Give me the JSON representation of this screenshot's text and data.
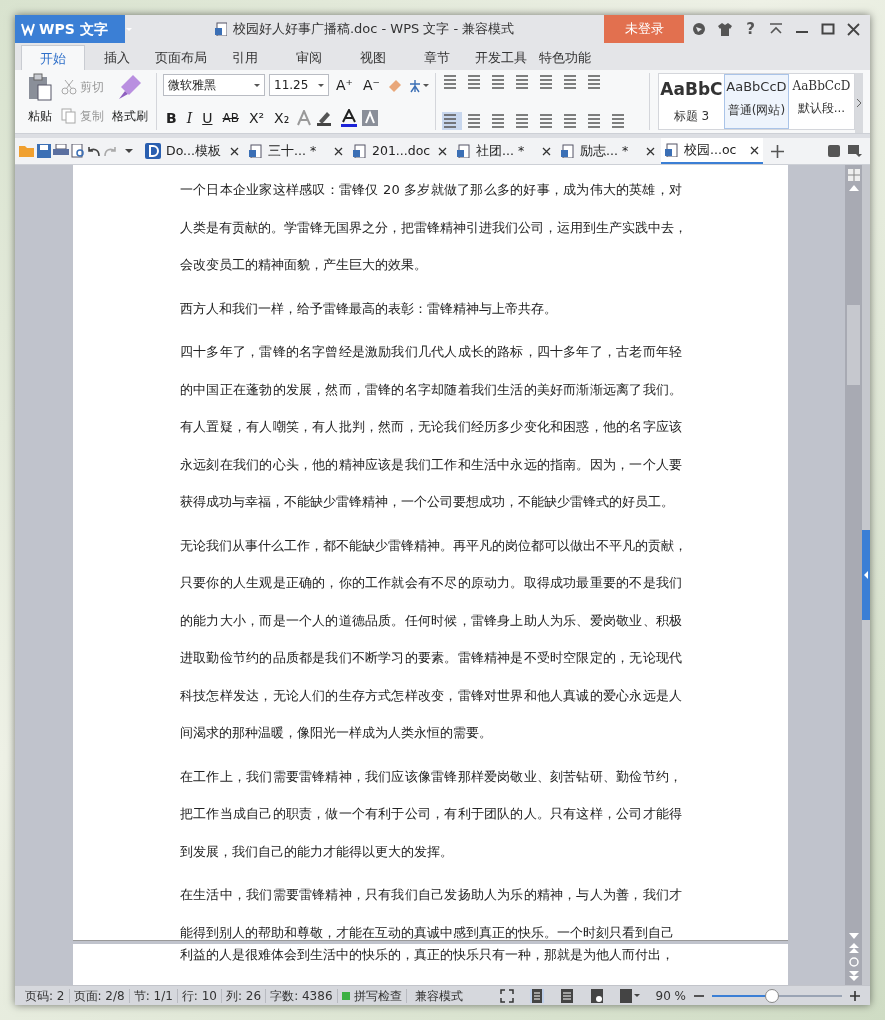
{
  "window": {
    "app_button": "WPS 文字",
    "title": "校园好人好事广播稿.doc - WPS 文字 - 兼容模式",
    "login_button": "未登录",
    "help": "?"
  },
  "menu_tabs": [
    {
      "label": "开始",
      "selected": true
    },
    {
      "label": "插入",
      "selected": false
    },
    {
      "label": "页面布局",
      "selected": false
    },
    {
      "label": "引用",
      "selected": false
    },
    {
      "label": "审阅",
      "selected": false
    },
    {
      "label": "视图",
      "selected": false
    },
    {
      "label": "章节",
      "selected": false
    },
    {
      "label": "开发工具",
      "selected": false
    },
    {
      "label": "特色功能",
      "selected": false
    }
  ],
  "ribbon": {
    "paste": "粘贴",
    "cut": {
      "label": "剪切",
      "disabled": true
    },
    "copy": {
      "label": "复制",
      "disabled": true
    },
    "format_painter": "格式刷",
    "font_name": "微软雅黑",
    "font_size": "11.25",
    "format_buttons": [
      {
        "glyph": "B",
        "kind": "bold"
      },
      {
        "glyph": "I",
        "kind": "italic"
      },
      {
        "glyph": "U",
        "kind": "underline"
      },
      {
        "glyph": "AB",
        "kind": "strike"
      },
      {
        "glyph": "X²",
        "kind": "plain"
      },
      {
        "glyph": "X₂",
        "kind": "plain"
      }
    ],
    "grow_font": "A⁺",
    "shrink_font": "A⁻",
    "styles": [
      {
        "preview": "AaBbC",
        "label": "标题 3",
        "kind": "heading",
        "selected": false
      },
      {
        "preview": "AaBbCcD",
        "label": "普通(网站)",
        "kind": "normal",
        "selected": true
      },
      {
        "preview": "AaBbCcD",
        "label": "默认段...",
        "kind": "serif",
        "selected": false
      }
    ]
  },
  "doc_tabs": [
    {
      "label": "Do...模板",
      "kind": "template",
      "selected": false
    },
    {
      "label": "三十... *",
      "kind": "document",
      "selected": false
    },
    {
      "label": "201...doc",
      "kind": "document",
      "selected": false
    },
    {
      "label": "社团... *",
      "kind": "document",
      "selected": false
    },
    {
      "label": "励志... *",
      "kind": "document",
      "selected": false
    },
    {
      "label": "校园...oc",
      "kind": "document",
      "selected": true
    }
  ],
  "pages": [
    {
      "paragraphs": [
        {
          "lines": [
            "一个日本企业家这样感叹：雷锋仅 20 多岁就做了那么多的好事，成为伟大的英雄，对",
            "人类是有贡献的。学雷锋无国界之分，把雷锋精神引进我们公司，运用到生产实践中去，",
            "会改变员工的精神面貌，产生巨大的效果。"
          ]
        },
        {
          "lines": [
            "西方人和我们一样，给予雷锋最高的表彰：雷锋精神与上帝共存。"
          ]
        },
        {
          "lines": [
            "四十多年了，雷锋的名字曾经是激励我们几代人成长的路标，四十多年了，古老而年轻",
            "的中国正在蓬勃的发展，然而，雷锋的名字却随着我们生活的美好而渐渐远离了我们。",
            "有人置疑，有人嘲笑，有人批判，然而，无论我们经历多少变化和困惑，他的名字应该",
            "永远刻在我们的心头，他的精神应该是我们工作和生活中永远的指南。因为，一个人要",
            "获得成功与幸福，不能缺少雷锋精神，一个公司要想成功，不能缺少雷锋式的好员工。"
          ]
        },
        {
          "lines": [
            "无论我们从事什么工作，都不能缺少雷锋精神。再平凡的岗位都可以做出不平凡的贡献，",
            "只要你的人生观是正确的，你的工作就会有不尽的原动力。取得成功最重要的不是我们",
            "的能力大小，而是一个人的道德品质。任何时候，雷锋身上助人为乐、爱岗敬业、积极",
            "进取勤俭节约的品质都是我们不断学习的要素。雷锋精神是不受时空限定的，无论现代",
            "科技怎样发达，无论人们的生存方式怎样改变，雷锋对世界和他人真诚的爱心永远是人",
            "间渴求的那种温暖，像阳光一样成为人类永恒的需要。"
          ]
        },
        {
          "lines": [
            "在工作上，我们需要雷锋精神，我们应该像雷锋那样爱岗敬业、刻苦钻研、勤俭节约，",
            "把工作当成自己的职责，做一个有利于公司，有利于团队的人。只有这样，公司才能得",
            "到发展，我们自己的能力才能得以更大的发挥。"
          ]
        },
        {
          "lines": [
            "在生活中，我们需要雷锋精神，只有我们自己发扬助人为乐的精神，与人为善，我们才",
            "能得到别人的帮助和尊敬，才能在互动的真诚中感到真正的快乐。一个时刻只看到自己"
          ]
        }
      ]
    },
    {
      "paragraphs": [
        {
          "lines": [
            "利益的人是很难体会到生活中的快乐的，真正的快乐只有一种，那就是为他人而付出，"
          ]
        }
      ]
    }
  ],
  "status_bar": {
    "items": [
      "页码: 2",
      "页面: 2/8",
      "节: 1/1",
      "行: 10",
      "列: 26",
      "字数: 4386"
    ],
    "spell_check": "拼写检查",
    "mode": "兼容模式",
    "zoom": "90 %",
    "zoom_slider": {
      "level": 0.46
    }
  }
}
